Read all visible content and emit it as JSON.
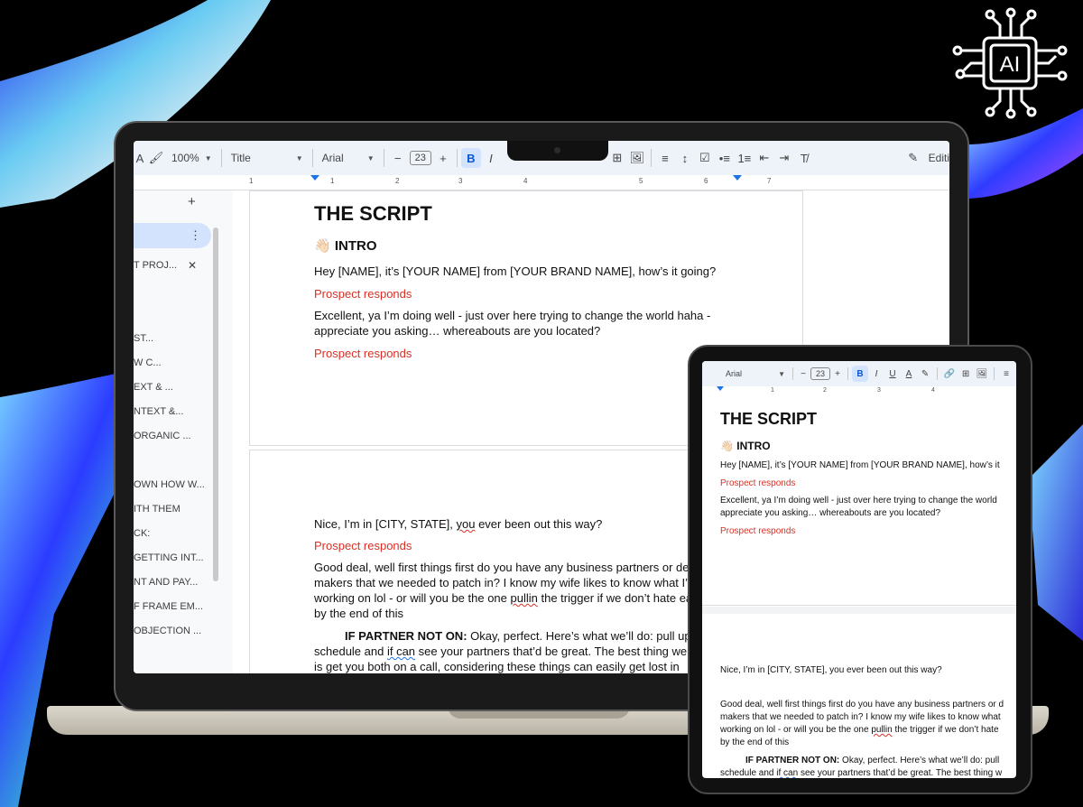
{
  "logo": {
    "text": "AI"
  },
  "toolbar": {
    "zoom": "100%",
    "style": "Title",
    "font": "Arial",
    "font_size": "23",
    "edit_label": "Editi",
    "bold": "B",
    "italic": "I",
    "underline": "U",
    "text_color": "A",
    "minus": "−",
    "plus": "+"
  },
  "ruler": {
    "ticks": [
      "1",
      "1",
      "2",
      "3",
      "4",
      "5",
      "6",
      "7"
    ]
  },
  "sidebar": {
    "add": "+",
    "more": "⋮",
    "close": "✕",
    "items": [
      "T PROJ...",
      "ST...",
      "W C...",
      "EXT & ...",
      "NTEXT &...",
      "ORGANIC ...",
      "OWN HOW W...",
      "ITH THEM",
      "CK:",
      "GETTING INT...",
      "NT AND PAY...",
      "F FRAME EM...",
      "OBJECTION ..."
    ]
  },
  "doc": {
    "title": "THE SCRIPT",
    "intro_emoji": "👋🏻",
    "intro": "INTRO",
    "p1": "Hey [NAME], it’s [YOUR NAME] from [YOUR BRAND NAME], how’s it going?",
    "prospect": "Prospect responds",
    "p2a": "Excellent, ya I’m doing well - just over here trying to change the world haha -",
    "p2b": "appreciate you asking… whereabouts are you located?",
    "p3a": "Nice, I’m in [CITY, STATE], ",
    "p3b": "you",
    "p3c": " ever been out this way?",
    "p4a": "Good deal, well first things first do you have any business partners or de",
    "p4b": "makers that we needed to patch in? I know my wife likes to know what I’",
    "p4c1": "working on lol - or will you be the one ",
    "p4c2": "pullin",
    "p4c3": " the trigger if we don’t hate ea",
    "p4d": "by the end of this",
    "p5label": "IF PARTNER NOT ON:",
    "p5a": " Okay, perfect. Here’s what we’ll do: pull up",
    "p5b1": "schedule and ",
    "p5b2": "if can",
    "p5b3": " see your partners that’d be great. The best thing we",
    "p5c": "is get you both on a call, considering these things can easily get lost in"
  },
  "tablet": {
    "font": "Arial",
    "font_size": "23",
    "ruler_ticks": [
      "1",
      "1",
      "2",
      "3",
      "4"
    ],
    "p1": "Hey [NAME], it’s [YOUR NAME] from [YOUR BRAND NAME], how’s it",
    "p2a": "Excellent, ya I’m doing well - just over here trying to change the world",
    "p2b": "appreciate you asking… whereabouts are you located?",
    "p3": "Nice, I’m in [CITY, STATE], you ever been out this way?",
    "p4a": "Good deal, well first things first do you have any business partners or d",
    "p4b": "makers that we needed to patch in? I know my wife likes to know what",
    "p4c1": "working on lol - or will you be the one ",
    "p4c2": "pullin",
    "p4c3": " the trigger if we don’t hate",
    "p4d": "by the end of this",
    "p5label": "IF PARTNER NOT ON:",
    "p5a": " Okay, perfect. Here’s what we’ll do: pull",
    "p5b1": "schedule and ",
    "p5b2": "if can",
    "p5b3": " see your partners that’d be great. The best thing w"
  },
  "colors": {
    "accent": "#0b57d0",
    "prospect_red": "#d93025",
    "toolbar_bg": "#eef2f9"
  }
}
